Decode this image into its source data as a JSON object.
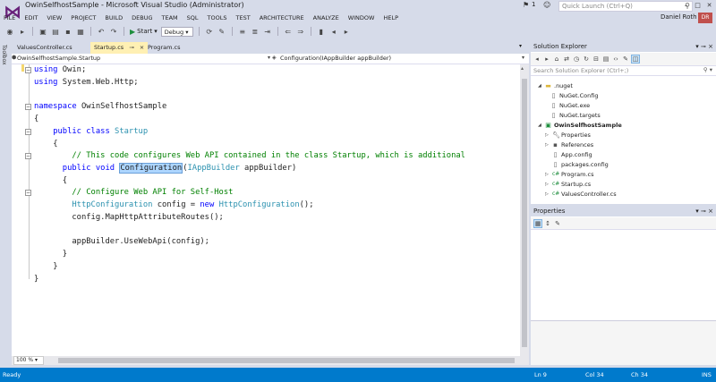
{
  "window": {
    "title": "OwinSelfhostSample - Microsoft Visual Studio (Administrator)",
    "notification_count": "1",
    "quick_launch_placeholder": "Quick Launch (Ctrl+Q)",
    "user_name": "Daniel Roth",
    "user_badge": "DR"
  },
  "menu": [
    "FILE",
    "EDIT",
    "VIEW",
    "PROJECT",
    "BUILD",
    "DEBUG",
    "TEAM",
    "SQL",
    "TOOLS",
    "TEST",
    "ARCHITECTURE",
    "ANALYZE",
    "WINDOW",
    "HELP"
  ],
  "toolbar": {
    "start_label": "Start",
    "config_value": "Debug"
  },
  "toolbox_label": "Toolbox",
  "tabs": [
    {
      "label": "ValuesController.cs",
      "active": false
    },
    {
      "label": "Startup.cs",
      "active": true
    },
    {
      "label": "Program.cs",
      "active": false
    }
  ],
  "navbar": {
    "left": "OwinSelfhostSample.Startup",
    "right": "Configuration(IAppBuilder appBuilder)"
  },
  "code": {
    "l1_kw": "using",
    "l1_rest": " Owin;",
    "l2_kw": "using",
    "l2_rest": " System.Web.Http;",
    "l4_kw": "namespace",
    "l4_rest": " OwinSelfhostSample",
    "l5": "{",
    "l6_kw": "public class",
    "l6_ty": " Startup",
    "l7": "{",
    "l8_cm": "// This code configures Web API contained in the class Startup, which is additional",
    "l9_kw": "public void",
    "l9_hl": "Configuration",
    "l9_p": "(",
    "l9_ty": "IAppBuilder",
    "l9_rest": " appBuilder)",
    "l10": "{",
    "l11_cm": "// Configure Web API for Self-Host",
    "l12_ty": "HttpConfiguration",
    "l12_a": " config = ",
    "l12_kw": "new",
    "l12_ty2": " HttpConfiguration",
    "l12_b": "();",
    "l13": "config.MapHttpAttributeRoutes();",
    "l15": "appBuilder.UseWebApi(config);",
    "l16": "}",
    "l17": "}",
    "l18": "}"
  },
  "zoom": "100 %",
  "solution_explorer": {
    "title": "Solution Explorer",
    "search_placeholder": "Search Solution Explorer (Ctrl+;)",
    "items": [
      {
        "label": ".nuget",
        "icon": "folder-icon"
      },
      {
        "label": "NuGet.Config",
        "icon": "file-icon"
      },
      {
        "label": "NuGet.exe",
        "icon": "file-icon"
      },
      {
        "label": "NuGet.targets",
        "icon": "file-icon"
      },
      {
        "label": "OwinSelfhostSample",
        "icon": "project-icon"
      },
      {
        "label": "Properties",
        "icon": "wrench-icon"
      },
      {
        "label": "References",
        "icon": "references-icon"
      },
      {
        "label": "App.config",
        "icon": "file-icon"
      },
      {
        "label": "packages.config",
        "icon": "file-icon"
      },
      {
        "label": "Program.cs",
        "icon": "csharp-icon"
      },
      {
        "label": "Startup.cs",
        "icon": "csharp-icon"
      },
      {
        "label": "ValuesController.cs",
        "icon": "csharp-icon"
      }
    ]
  },
  "properties": {
    "title": "Properties"
  },
  "status": {
    "text": "Ready",
    "ln": "Ln 9",
    "col": "Col 34",
    "ch": "Ch 34",
    "ins": "INS"
  }
}
